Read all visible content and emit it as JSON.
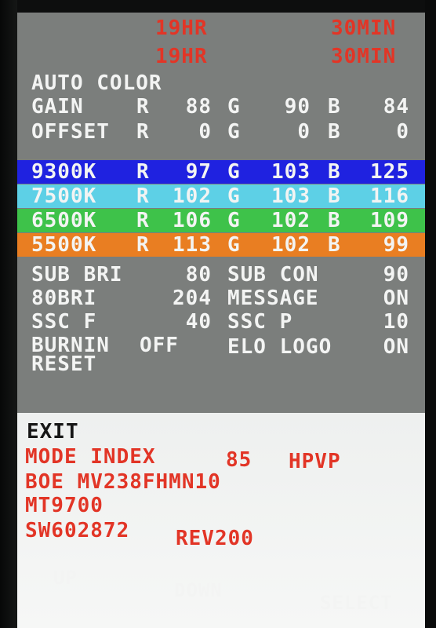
{
  "timers": {
    "row1": {
      "hours": "19HR",
      "minutes": "30MIN"
    },
    "row2": {
      "hours": "19HR",
      "minutes": "30MIN"
    }
  },
  "auto_color": "AUTO COLOR",
  "gain": {
    "label": "GAIN",
    "r_label": "R",
    "r": "88",
    "g_label": "G",
    "g": "90",
    "b_label": "B",
    "b": "84"
  },
  "offset": {
    "label": "OFFSET",
    "r_label": "R",
    "r": "0",
    "g_label": "G",
    "g": "0",
    "b_label": "B",
    "b": "0"
  },
  "color_temps": [
    {
      "name": "9300K",
      "r_label": "R",
      "r": "97",
      "g_label": "G",
      "g": "103",
      "b_label": "B",
      "b": "125",
      "color": "#1f22e0"
    },
    {
      "name": "7500K",
      "r_label": "R",
      "r": "102",
      "g_label": "G",
      "g": "103",
      "b_label": "B",
      "b": "116",
      "color": "#5dd0e6"
    },
    {
      "name": "6500K",
      "r_label": "R",
      "r": "106",
      "g_label": "G",
      "g": "102",
      "b_label": "B",
      "b": "109",
      "color": "#3ec24a"
    },
    {
      "name": "5500K",
      "r_label": "R",
      "r": "113",
      "g_label": "G",
      "g": "102",
      "b_label": "B",
      "b": "99",
      "color": "#e97e22"
    }
  ],
  "settings": {
    "sub_bri": {
      "label": "SUB BRI",
      "value": "80"
    },
    "sub_con": {
      "label": "SUB CON",
      "value": "90"
    },
    "bri80": {
      "label": "80BRI",
      "value": "204"
    },
    "message": {
      "label": "MESSAGE",
      "value": "ON"
    },
    "ssc_f": {
      "label": "SSC F",
      "value": "40"
    },
    "ssc_p": {
      "label": "SSC P",
      "value": "10"
    },
    "burnin": {
      "label": "BURNIN",
      "value": "OFF"
    },
    "elo_logo": {
      "label": "ELO LOGO",
      "value": "ON"
    },
    "reset": "RESET"
  },
  "exit": "EXIT",
  "info": {
    "mode_index_label": "MODE INDEX",
    "mode_index_value": "85",
    "mode_index_type": "HPVP",
    "panel": "BOE MV238FHMN10",
    "scaler": "MT9700",
    "sw": "SW602872",
    "rev": "REV200"
  },
  "nav": {
    "up": "UP",
    "down": "DOWN",
    "select": "SELECT"
  },
  "colors": {
    "menu_bg": "#7b7e7c",
    "text_white": "#f3f4f3",
    "text_red": "#e23526",
    "lower_bg": "#f2f3f2"
  }
}
